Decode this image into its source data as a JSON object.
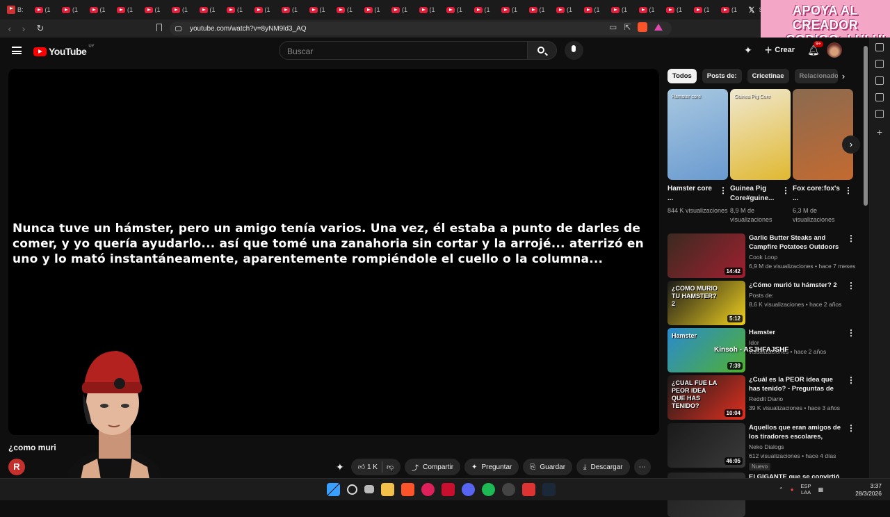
{
  "browser": {
    "tabs": [
      {
        "label": "B:",
        "icon": "brave-tab-icon"
      },
      {
        "label": "(1",
        "icon": "youtube-icon"
      },
      {
        "label": "(1",
        "icon": "youtube-icon"
      },
      {
        "label": "(1",
        "icon": "youtube-icon"
      },
      {
        "label": "(1",
        "icon": "youtube-icon"
      },
      {
        "label": "(1",
        "icon": "youtube-icon"
      },
      {
        "label": "(1",
        "icon": "youtube-icon"
      },
      {
        "label": "(1",
        "icon": "youtube-icon"
      },
      {
        "label": "(1",
        "icon": "youtube-icon"
      },
      {
        "label": "(1",
        "icon": "youtube-icon"
      },
      {
        "label": "(1",
        "icon": "youtube-icon"
      },
      {
        "label": "(1",
        "icon": "youtube-icon"
      },
      {
        "label": "(1",
        "icon": "youtube-icon"
      },
      {
        "label": "(1",
        "icon": "youtube-icon"
      },
      {
        "label": "(1",
        "icon": "youtube-icon"
      },
      {
        "label": "(1",
        "icon": "youtube-icon"
      },
      {
        "label": "(1",
        "icon": "youtube-icon"
      },
      {
        "label": "(1",
        "icon": "youtube-icon"
      },
      {
        "label": "(1",
        "icon": "youtube-icon"
      },
      {
        "label": "(1",
        "icon": "youtube-icon"
      },
      {
        "label": "(1",
        "icon": "youtube-icon"
      },
      {
        "label": "(1",
        "icon": "youtube-icon"
      },
      {
        "label": "(1",
        "icon": "youtube-icon"
      },
      {
        "label": "(1",
        "icon": "youtube-icon"
      },
      {
        "label": "(1",
        "icon": "youtube-icon"
      },
      {
        "label": "(1",
        "icon": "youtube-icon"
      },
      {
        "label": "(1",
        "icon": "youtube-icon"
      },
      {
        "label": "Sh",
        "icon": "x-icon"
      }
    ],
    "url": "youtube.com/watch?v=8yNM9ld3_AQ",
    "promo": {
      "line1": "APOYA AL CREADOR",
      "line2": "CODIGO: LULUI"
    }
  },
  "header": {
    "logo_text": "YouTube",
    "country": "UY",
    "search_placeholder": "Buscar",
    "create_label": "Crear",
    "notif_count": "9+"
  },
  "player": {
    "caption": "Nunca tuve un hámster, pero un amigo tenía varios. Una vez, él estaba a punto de darles de comer, y yo quería ayudarlo... así que tomé una zanahoria sin cortar y la arrojé... aterrizó en uno y lo mató instantáneamente, aparentemente rompiéndole el cuello o la columna...",
    "title": "¿como muri",
    "channel_initial": "R",
    "actions": {
      "likes": "1 K",
      "share": "Compartir",
      "ask": "Preguntar",
      "save": "Guardar",
      "download": "Descargar"
    }
  },
  "chips": [
    "Todos",
    "Posts de:",
    "Cricetinae",
    "Relacionado"
  ],
  "shorts": [
    {
      "title": "Hamster core ...",
      "views": "844 K visualizaciones",
      "thumb_label": "Hamster core",
      "colors": [
        "#a8c8e0",
        "#6a9ad0"
      ]
    },
    {
      "title": "Guinea Pig Core#guine...",
      "views": "8,9 M de visualizaciones",
      "thumb_label": "Guinea Pig Core",
      "colors": [
        "#f0e8d0",
        "#e0b830"
      ]
    },
    {
      "title": "Fox core:fox's ...",
      "views": "6,3 M de visualizaciones",
      "thumb_label": "",
      "colors": [
        "#8a6a50",
        "#c46a30"
      ]
    }
  ],
  "recommendations": [
    {
      "title": "Garlic Butter Steaks and Campfire Potatoes Outdoors",
      "channel": "Cook Loop",
      "views": "6,9 M de visualizaciones",
      "age": "hace 7 meses",
      "duration": "14:42",
      "colors": [
        "#3a2a20",
        "#a02030"
      ],
      "badge": ""
    },
    {
      "title": "¿Cómo murió tu hámster? 2",
      "channel": "Posts de:",
      "views": "8,6 K visualizaciones",
      "age": "hace 2 años",
      "duration": "5:12",
      "colors": [
        "#1a1a1a",
        "#f0d020"
      ],
      "badge": "",
      "thumb_text": "¿COMO MURIO TU HAMSTER? 2"
    },
    {
      "title": "Hamster",
      "channel": "Idor",
      "views": "visualizaciones",
      "age": "hace 2 años",
      "duration": "7:39",
      "colors": [
        "#2a8ad0",
        "#50b030"
      ],
      "badge": "",
      "thumb_text": "Hamster"
    },
    {
      "title": "¿Cuál es la PEOR idea que has tenido? - Preguntas de Reddit.",
      "channel": "Reddit Diario",
      "views": "39 K visualizaciones",
      "age": "hace 3 años",
      "duration": "10:04",
      "colors": [
        "#1a1a1a",
        "#e03020"
      ],
      "badge": "",
      "thumb_text": "¿CUAL FUE LA PEOR IDEA QUE HAS TENIDO?"
    },
    {
      "title": "Aquellos que eran amigos de los tiradores escolares, ¿cómo...",
      "channel": "Neko Dialogs",
      "views": "612 visualizaciones",
      "age": "hace 4 días",
      "duration": "46:05",
      "colors": [
        "#1a1a1a",
        "#3a3a3a"
      ],
      "badge": "Nuevo"
    },
    {
      "title": "El GIGANTE que se convirtió en...",
      "channel": "",
      "views": "",
      "age": "",
      "duration": "",
      "colors": [
        "#222",
        "#333"
      ],
      "badge": ""
    }
  ],
  "overlay": "Kinsoh - ASJHFAJSHF",
  "taskbar": {
    "lang1": "ESP",
    "lang2": "LAA",
    "time": "3:37",
    "date": "28/3/2026"
  }
}
